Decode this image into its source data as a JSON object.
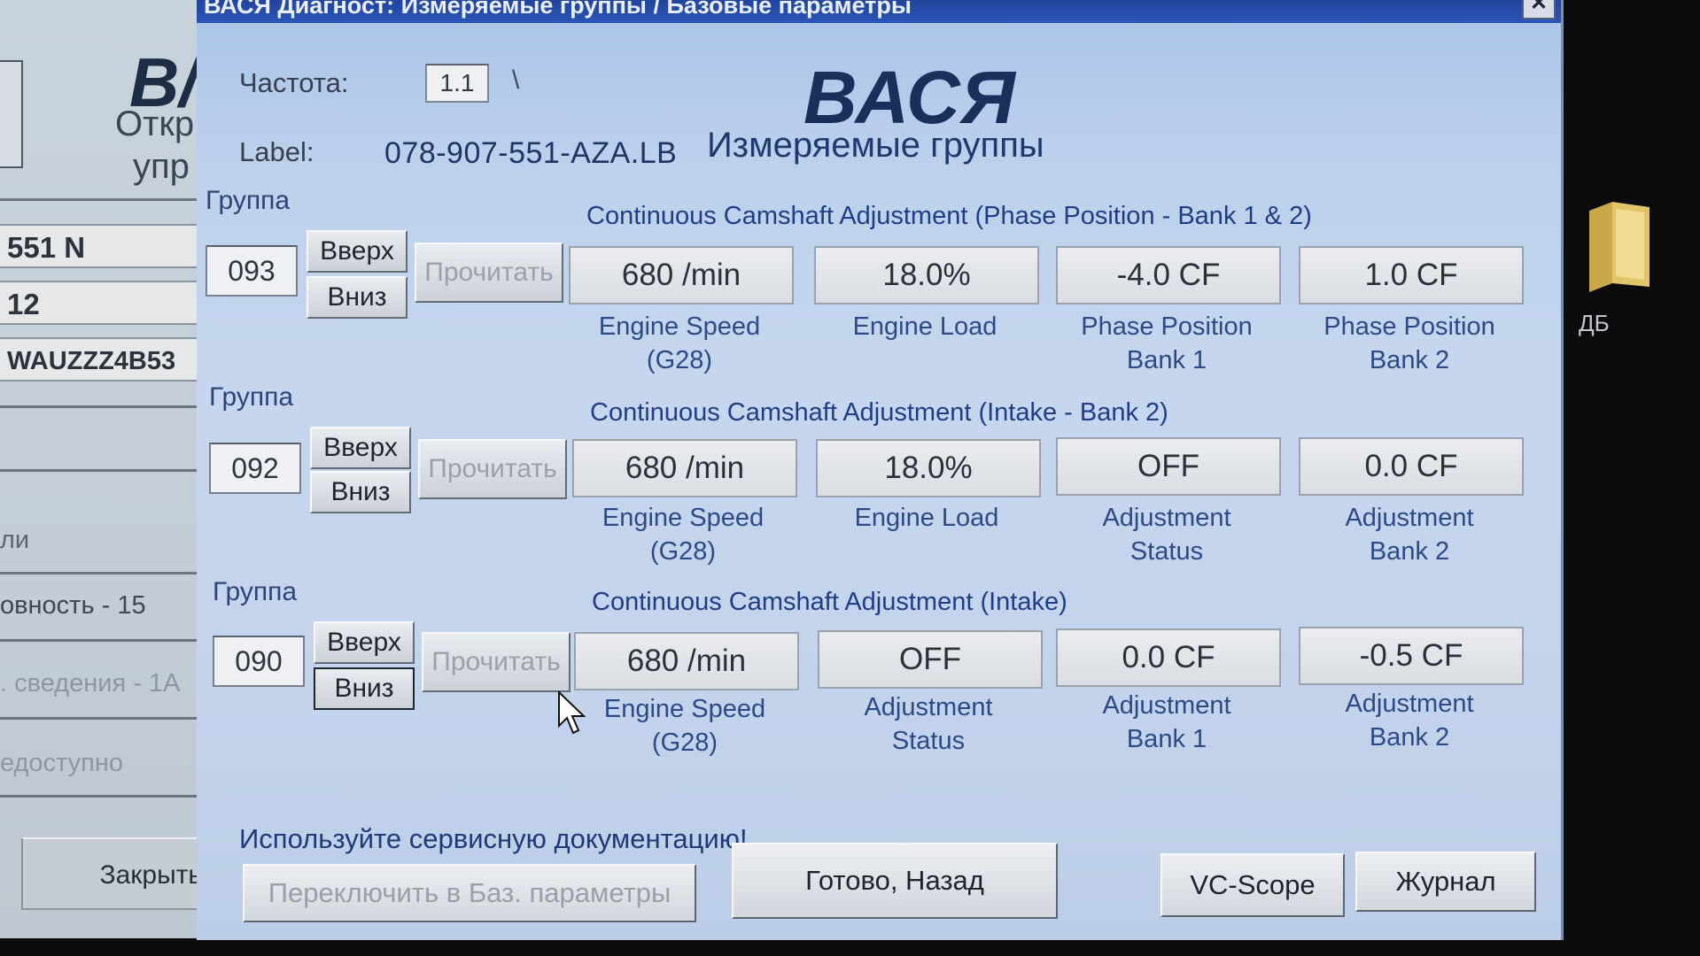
{
  "background_window": {
    "logo_partial": "B/",
    "line1": "Откр",
    "line2": "упр",
    "field1": "551 N",
    "field2": "12",
    "field3": "WAUZZZ4B53",
    "text1": "ли",
    "text2": "овность - 15",
    "text3": ". сведения - 1А",
    "text4": "едоступно",
    "close_label": "Закрыть"
  },
  "desktop": {
    "folder_label": "ДБ"
  },
  "window": {
    "title": "ВАСЯ Диагност: Измеряемые группы / Базовые параметры",
    "close_glyph": "✕"
  },
  "header": {
    "freq_label": "Частота:",
    "freq_value": "1.1",
    "freq_indicator": "\\",
    "label_caption": "Label:",
    "label_value": "078-907-551-AZA.LB",
    "app_name": "ВАСЯ",
    "app_subtitle": "Измеряемые группы"
  },
  "groups": [
    {
      "caption": "Группа",
      "number": "093",
      "up_label": "Вверх",
      "down_label": "Вниз",
      "read_label": "Прочитать",
      "title": "Continuous Camshaft Adjustment (Phase Position - Bank 1 & 2)",
      "fields": [
        {
          "value": "680 /min",
          "caption1": "Engine Speed",
          "caption2": "(G28)"
        },
        {
          "value": "18.0%",
          "caption1": "Engine Load",
          "caption2": ""
        },
        {
          "value": "-4.0 CF",
          "caption1": "Phase Position",
          "caption2": "Bank 1"
        },
        {
          "value": "1.0 CF",
          "caption1": "Phase Position",
          "caption2": "Bank 2"
        }
      ]
    },
    {
      "caption": "Группа",
      "number": "092",
      "up_label": "Вверх",
      "down_label": "Вниз",
      "read_label": "Прочитать",
      "title": "Continuous Camshaft Adjustment (Intake - Bank 2)",
      "fields": [
        {
          "value": "680 /min",
          "caption1": "Engine Speed",
          "caption2": "(G28)"
        },
        {
          "value": "18.0%",
          "caption1": "Engine Load",
          "caption2": ""
        },
        {
          "value": "OFF",
          "caption1": "Adjustment",
          "caption2": "Status"
        },
        {
          "value": "0.0 CF",
          "caption1": "Adjustment",
          "caption2": "Bank 2"
        }
      ]
    },
    {
      "caption": "Группа",
      "number": "090",
      "up_label": "Вверх",
      "down_label": "Вниз",
      "read_label": "Прочитать",
      "title": "Continuous Camshaft Adjustment (Intake)",
      "fields": [
        {
          "value": "680 /min",
          "caption1": "Engine Speed",
          "caption2": "(G28)"
        },
        {
          "value": "OFF",
          "caption1": "Adjustment",
          "caption2": "Status"
        },
        {
          "value": "0.0 CF",
          "caption1": "Adjustment",
          "caption2": "Bank 1"
        },
        {
          "value": "-0.5 CF",
          "caption1": "Adjustment",
          "caption2": "Bank 2"
        }
      ]
    }
  ],
  "footer": {
    "note": "Используйте сервисную документацию!",
    "switch_label": "Переключить в Баз. параметры",
    "done_label": "Готово, Назад",
    "scope_label": "VC-Scope",
    "log_label": "Журнал"
  }
}
